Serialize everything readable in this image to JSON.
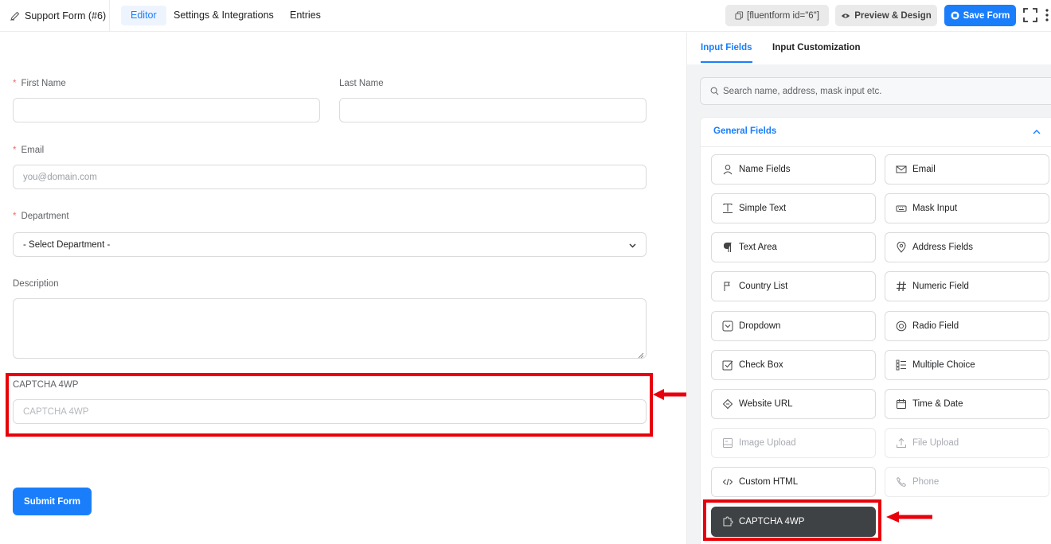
{
  "topbar": {
    "form_title": "Support Form (#6)",
    "tabs": [
      {
        "label": "Editor",
        "active": true
      },
      {
        "label": "Settings & Integrations",
        "active": false
      },
      {
        "label": "Entries",
        "active": false
      }
    ],
    "shortcode": "[fluentform id=\"6\"]",
    "preview_label": "Preview & Design",
    "save_label": "Save Form"
  },
  "form": {
    "first_name": {
      "label": "First Name",
      "required": true,
      "value": ""
    },
    "last_name": {
      "label": "Last Name",
      "required": false,
      "value": ""
    },
    "email": {
      "label": "Email",
      "required": true,
      "placeholder": "you@domain.com"
    },
    "department": {
      "label": "Department",
      "required": true,
      "selected": "- Select Department -"
    },
    "description": {
      "label": "Description",
      "value": ""
    },
    "captcha": {
      "label": "CAPTCHA 4WP",
      "placeholder": "CAPTCHA 4WP"
    },
    "submit_label": "Submit Form"
  },
  "sidebar": {
    "tabs": [
      {
        "label": "Input Fields",
        "active": true
      },
      {
        "label": "Input Customization",
        "active": false
      }
    ],
    "search_placeholder": "Search name, address, mask input etc.",
    "section_title": "General Fields",
    "fields": [
      {
        "label": "Name Fields",
        "icon": "person-icon",
        "state": "enabled"
      },
      {
        "label": "Email",
        "icon": "envelope-icon",
        "state": "enabled"
      },
      {
        "label": "Simple Text",
        "icon": "text-cursor-icon",
        "state": "enabled"
      },
      {
        "label": "Mask Input",
        "icon": "keyboard-icon",
        "state": "enabled"
      },
      {
        "label": "Text Area",
        "icon": "paragraph-icon",
        "state": "enabled"
      },
      {
        "label": "Address Fields",
        "icon": "map-pin-icon",
        "state": "enabled"
      },
      {
        "label": "Country List",
        "icon": "flag-icon",
        "state": "enabled"
      },
      {
        "label": "Numeric Field",
        "icon": "hash-icon",
        "state": "enabled"
      },
      {
        "label": "Dropdown",
        "icon": "dropdown-icon",
        "state": "enabled"
      },
      {
        "label": "Radio Field",
        "icon": "radio-icon",
        "state": "enabled"
      },
      {
        "label": "Check Box",
        "icon": "checkbox-icon",
        "state": "enabled"
      },
      {
        "label": "Multiple Choice",
        "icon": "list-icon",
        "state": "enabled"
      },
      {
        "label": "Website URL",
        "icon": "link-icon",
        "state": "enabled"
      },
      {
        "label": "Time & Date",
        "icon": "calendar-icon",
        "state": "enabled"
      },
      {
        "label": "Image Upload",
        "icon": "image-icon",
        "state": "disabled"
      },
      {
        "label": "File Upload",
        "icon": "upload-icon",
        "state": "disabled"
      },
      {
        "label": "Custom HTML",
        "icon": "code-icon",
        "state": "enabled"
      },
      {
        "label": "Phone",
        "icon": "phone-icon",
        "state": "disabled"
      },
      {
        "label": "CAPTCHA 4WP",
        "icon": "puzzle-icon",
        "state": "highlighted"
      }
    ]
  },
  "annotations": {
    "highlight_color": "#e8000b",
    "accent_color": "#1a7efb"
  }
}
